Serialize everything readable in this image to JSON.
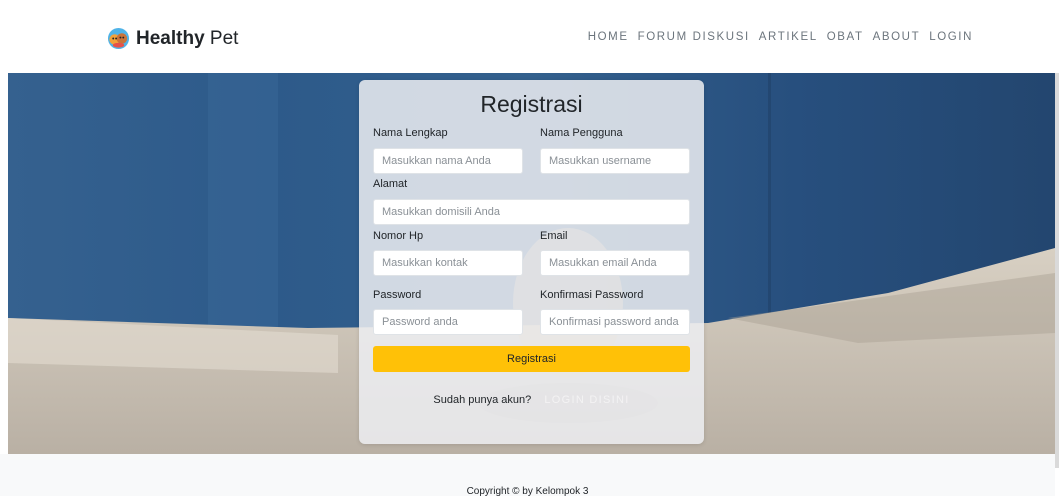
{
  "navbar": {
    "brand_bold": "Healthy",
    "brand_light": " Pet",
    "logo_icon": "dog-cat-logo-icon",
    "links": [
      "HOME",
      "FORUM DISKUSI",
      "ARTIKEL",
      "OBAT",
      "ABOUT",
      "LOGIN"
    ]
  },
  "form": {
    "title": "Registrasi",
    "fields": {
      "nama_lengkap": {
        "label": "Nama Lengkap",
        "placeholder": "Masukkan nama Anda",
        "value": ""
      },
      "nama_pengguna": {
        "label": "Nama Pengguna",
        "placeholder": "Masukkan username",
        "value": ""
      },
      "alamat": {
        "label": "Alamat",
        "placeholder": "Masukkan domisili Anda",
        "value": ""
      },
      "nomor_hp": {
        "label": "Nomor Hp",
        "placeholder": "Masukkan kontak",
        "value": ""
      },
      "email": {
        "label": "Email",
        "placeholder": "Masukkan email Anda",
        "value": ""
      },
      "password": {
        "label": "Password",
        "placeholder": "Password anda",
        "value": ""
      },
      "konfirmasi": {
        "label": "Konfirmasi Password",
        "placeholder": "Konfirmasi password anda",
        "value": ""
      }
    },
    "submit_label": "Registrasi",
    "login_question": "Sudah punya akun?",
    "login_link": "LOGIN DISINI"
  },
  "colors": {
    "accent_button": "#ffc107",
    "hero_blue": "#2f5d8e",
    "footer_bg": "#f8f9fa"
  },
  "footer": {
    "copyright": "Copyright © by Kelompok 3"
  }
}
